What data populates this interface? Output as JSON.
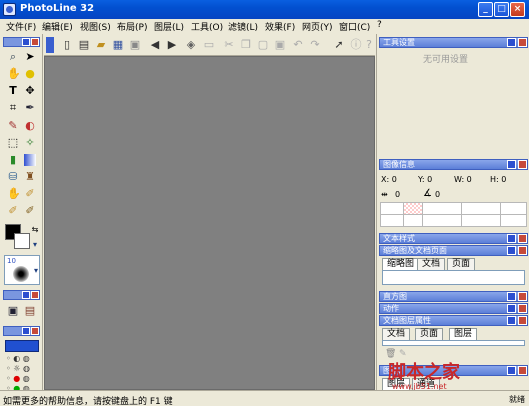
{
  "window": {
    "title": "PhotoLine 32",
    "minimize": "_",
    "maximize": "□",
    "close": "×"
  },
  "menu": [
    "文件(F)",
    "编辑(E)",
    "视图(S)",
    "布局(P)",
    "图层(L)",
    "工具(O)",
    "滤镜(L)",
    "效果(F)",
    "网页(Y)",
    "窗口(C)",
    "?"
  ],
  "toolbar": {
    "icons": [
      "new-icon",
      "open-icon",
      "open-folder-icon",
      "browse-icon",
      "save-icon",
      "back-icon",
      "forward-icon",
      "scan-icon",
      "print-icon",
      "cut-icon",
      "copy-icon",
      "paste-icon",
      "paste-new-icon",
      "undo-icon",
      "redo-icon",
      "whats-this-icon",
      "info-icon",
      "help-icon"
    ]
  },
  "panels": {
    "tool_settings": {
      "title": "工具设置",
      "body": "无可用设置"
    },
    "image_info": {
      "title": "图像信息",
      "x_label": "X: 0",
      "y_label": "Y: 0",
      "w_label": "W: 0",
      "h_label": "H: 0",
      "dist_label": "0",
      "angle_label": "0"
    },
    "text_style": {
      "title": "文本样式"
    },
    "thumb_doc": {
      "title": "缩略图及文档页面"
    },
    "thumb_tabs": [
      "缩略图",
      "文档",
      "页面"
    ],
    "histogram": {
      "title": "直方图"
    },
    "actions": {
      "title": "动作"
    },
    "doc_layer_props": {
      "title": "文档图层属性"
    },
    "layer_tabs": [
      "文档",
      "页面",
      "图层"
    ],
    "layers_panel": {
      "title": "图层/"
    },
    "bottom_tabs": [
      "图层",
      "通道"
    ]
  },
  "left_panel": {
    "brush_size": "10"
  },
  "status": {
    "text": "如需更多的帮助信息，请按键盘上的 F1 键",
    "right": "就绪"
  },
  "watermark": {
    "main": "脚本之家",
    "url": "www.jb51.net"
  }
}
